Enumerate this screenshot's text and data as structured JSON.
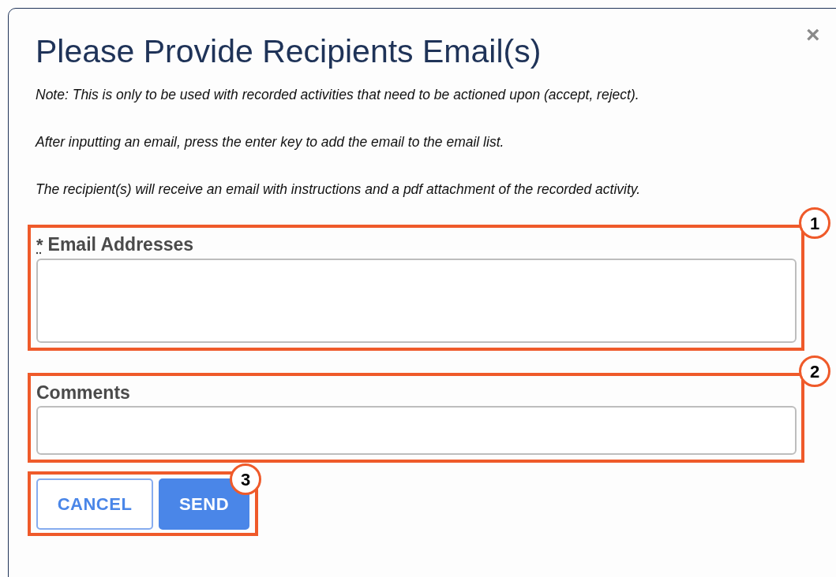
{
  "dialog": {
    "title": "Please Provide Recipients Email(s)",
    "close": "×"
  },
  "notes": [
    "Note: This is only to be used with recorded activities that need to be actioned upon (accept, reject).",
    "After inputting an email, press the enter key to add the email to the email list.",
    "The recipient(s) will receive an email with instructions and a pdf attachment of the recorded activity."
  ],
  "fields": [
    {
      "kind": "textarea",
      "required_mark": "*",
      "label": "Email Addresses",
      "callout": "1"
    },
    {
      "kind": "input",
      "label": "Comments",
      "callout": "2"
    }
  ],
  "actions": {
    "callout": "3",
    "buttons": [
      {
        "kind": "outline",
        "label": "CANCEL"
      },
      {
        "kind": "primary",
        "label": "SEND"
      }
    ]
  }
}
